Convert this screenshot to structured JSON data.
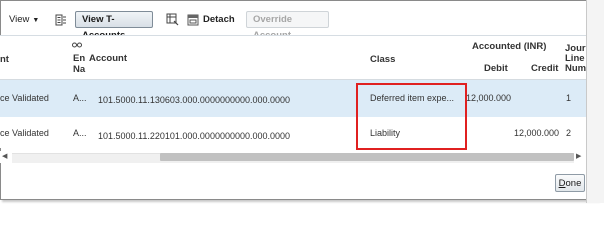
{
  "toolbar": {
    "view_label": "View",
    "view_t_accounts_label": "View T-Accounts",
    "detach_label": "Detach",
    "override_account_label": "Override Account"
  },
  "table": {
    "headers": {
      "col_partial_left": "nt",
      "col_entity_l1": "En",
      "col_entity_l2": "Na",
      "col_account": "Account",
      "col_class": "Class",
      "group_accounted": "Accounted (INR)",
      "col_debit": "Debit",
      "col_credit": "Credit",
      "col_journal_l1": "Journ",
      "col_journal_l2": "Line",
      "col_journal_l3": "Numb"
    },
    "rows": [
      {
        "status": "ce Validated",
        "entity": "A...",
        "account": "101.5000.11.130603.000.0000000000.000.0000",
        "class": "Deferred item expe...",
        "debit": "12,000.000",
        "credit": "",
        "line": "1"
      },
      {
        "status": "ce Validated",
        "entity": "A...",
        "account": "101.5000.11.220101.000.0000000000.000.0000",
        "class": "Liability",
        "debit": "",
        "credit": "12,000.000",
        "line": "2"
      }
    ]
  },
  "footer": {
    "done_label_first": "D",
    "done_label_rest": "one"
  },
  "colors": {
    "selected_row": "#dcebf7",
    "highlight_box": "#e02020"
  }
}
